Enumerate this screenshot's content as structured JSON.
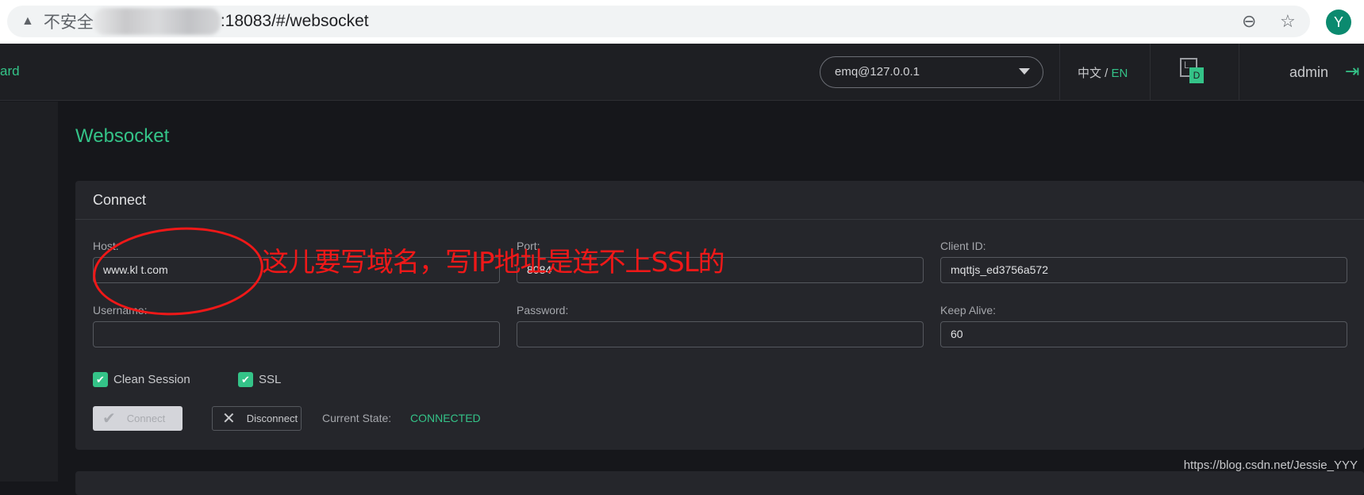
{
  "browser": {
    "insecure_label": "不安全",
    "url_suffix": ":18083/#/websocket",
    "avatar_letter": "Y"
  },
  "header": {
    "brand_partial": "ard",
    "node": "emq@127.0.0.1",
    "lang_zh": "中文",
    "lang_sep": " / ",
    "lang_en": "EN",
    "ld_l": "L",
    "ld_d": "D",
    "user": "admin"
  },
  "page": {
    "title": "Websocket"
  },
  "connect": {
    "title": "Connect",
    "host_label": "Host:",
    "host_value": "www.kl   t.com",
    "port_label": "Port:",
    "port_value": "8084",
    "client_label": "Client ID:",
    "client_value": "mqttjs_ed3756a572",
    "username_label": "Username:",
    "username_value": "",
    "password_label": "Password:",
    "password_value": "",
    "keepalive_label": "Keep Alive:",
    "keepalive_value": "60",
    "clean_session_label": "Clean Session",
    "clean_session_checked": true,
    "ssl_label": "SSL",
    "ssl_checked": true,
    "connect_button": "Connect",
    "disconnect_button": "Disconnect",
    "state_label": "Current State:",
    "state_value": "CONNECTED"
  },
  "annotation": "这儿要写域名，写IP地址是连不上SSL的",
  "watermark": "https://blog.csdn.net/Jessie_YYY",
  "colors": {
    "accent": "#34c388",
    "annotation": "#f01818"
  }
}
